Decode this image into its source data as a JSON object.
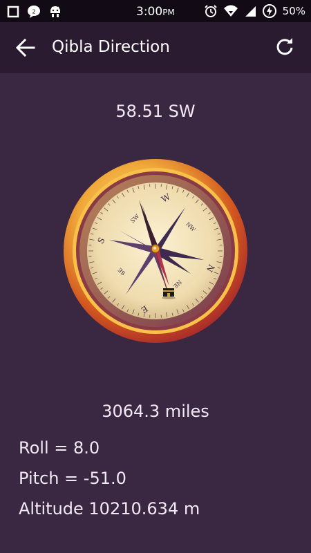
{
  "status_bar": {
    "time": "3:00",
    "time_suffix": "PM",
    "battery": "50%",
    "notification_icons": [
      "square-icon",
      "chat-badge-icon",
      "android-icon"
    ],
    "system_icons": [
      "alarm-icon",
      "wifi-icon",
      "signal-icon",
      "battery-saver-icon"
    ]
  },
  "app_bar": {
    "title": "Qibla Direction",
    "back_icon": "arrow-left-icon",
    "refresh_icon": "refresh-icon"
  },
  "compass": {
    "heading": "58.51 SW",
    "dial_letters": [
      "N",
      "S",
      "E",
      "W"
    ],
    "dial_intercardinals": [
      "NE",
      "NW",
      "SE",
      "SW"
    ]
  },
  "distance": "3064.3 miles",
  "sensors": {
    "roll": "Roll = 8.0",
    "pitch": "Pitch = -51.0",
    "altitude": "Altitude 10210.634 m"
  },
  "colors": {
    "background": "#3a2742",
    "app_bar": "#2a1b30",
    "status_bar": "#120b16",
    "ring_gold": "#e8a23a",
    "dial_face": "#f1e4bd",
    "needle": "#b0344d"
  }
}
